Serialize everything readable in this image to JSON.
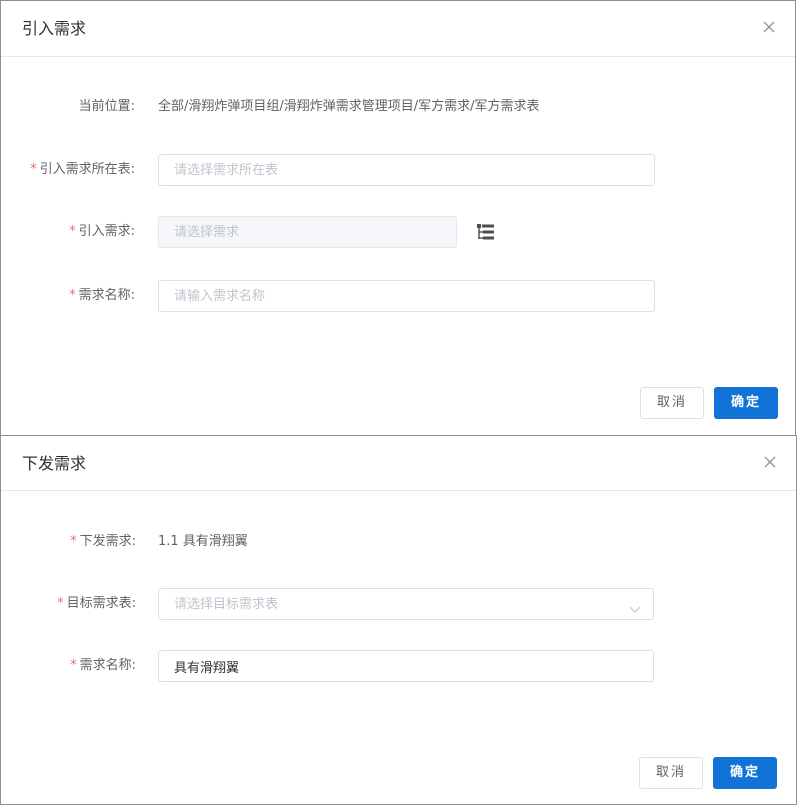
{
  "dialog_import": {
    "title": "引入需求",
    "location_label": "当前位置:",
    "location_value": "全部/滑翔炸弹项目组/滑翔炸弹需求管理项目/军方需求/军方需求表",
    "source_table_label": "引入需求所在表:",
    "source_table_placeholder": "请选择需求所在表",
    "requirement_label": "引入需求:",
    "requirement_placeholder": "请选择需求",
    "name_label": "需求名称:",
    "name_placeholder": "请输入需求名称",
    "cancel_label": "取消",
    "ok_label": "确定",
    "required_mark": "*"
  },
  "dialog_issue": {
    "title": "下发需求",
    "issue_label": "下发需求:",
    "issue_value": "1.1 具有滑翔翼",
    "target_table_label": "目标需求表:",
    "target_table_placeholder": "请选择目标需求表",
    "name_label": "需求名称:",
    "name_value": "具有滑翔翼",
    "cancel_label": "取消",
    "ok_label": "确定",
    "required_mark": "*"
  },
  "colors": {
    "primary": "#1172d7",
    "required": "#f56c6c",
    "border": "#dcdfe6"
  }
}
